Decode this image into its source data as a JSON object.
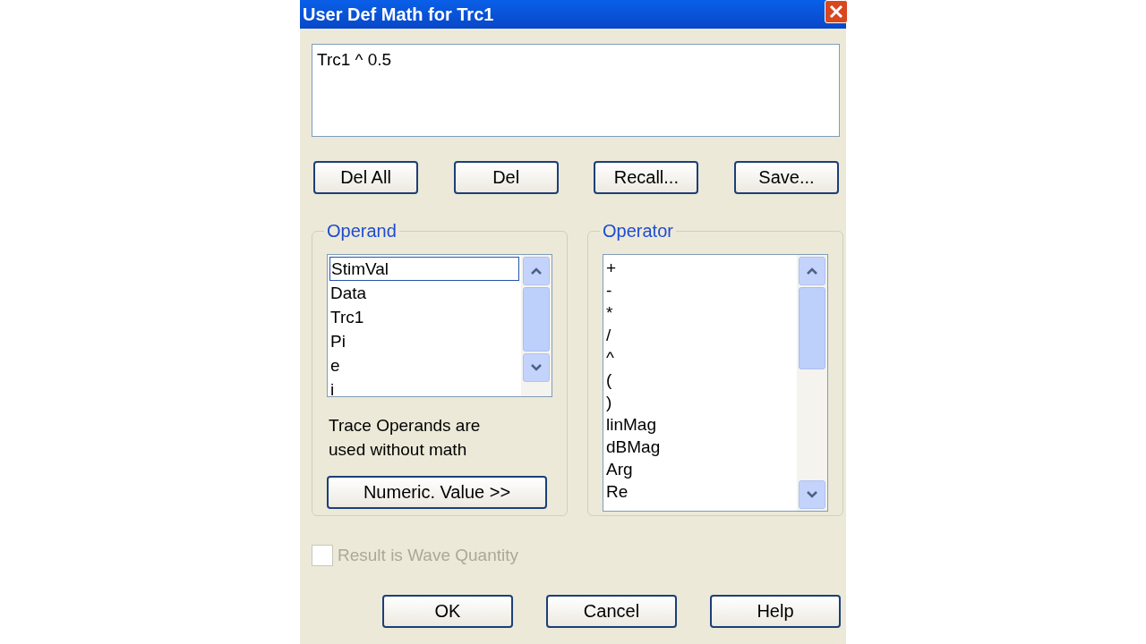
{
  "window": {
    "title": "User Def Math for Trc1"
  },
  "expression": {
    "value": "Trc1 ^ 0.5"
  },
  "edit_buttons": [
    "Del All",
    "Del",
    "Recall...",
    "Save..."
  ],
  "operand": {
    "label": "Operand",
    "items": [
      {
        "label": "StimVal",
        "selected": true
      },
      {
        "label": "Data",
        "selected": false
      },
      {
        "label": "Trc1",
        "selected": false
      },
      {
        "label": "Pi",
        "selected": false
      },
      {
        "label": "e",
        "selected": false
      },
      {
        "label": "i",
        "selected": false
      }
    ],
    "note": "Trace Operands are used without math",
    "button": "Numeric. Value >>"
  },
  "operator": {
    "label": "Operator",
    "items": [
      {
        "label": "+",
        "selected": false
      },
      {
        "label": "-",
        "selected": false
      },
      {
        "label": "*",
        "selected": false
      },
      {
        "label": "/",
        "selected": false
      },
      {
        "label": "^",
        "selected": false
      },
      {
        "label": "(",
        "selected": false
      },
      {
        "label": ")",
        "selected": false
      },
      {
        "label": "linMag",
        "selected": false
      },
      {
        "label": "dBMag",
        "selected": false
      },
      {
        "label": "Arg",
        "selected": false
      },
      {
        "label": "Re",
        "selected": false
      }
    ]
  },
  "wave_checkbox": {
    "label": "Result is Wave Quantity",
    "checked": false,
    "disabled": true
  },
  "buttons": [
    "OK",
    "Cancel",
    "Help"
  ]
}
